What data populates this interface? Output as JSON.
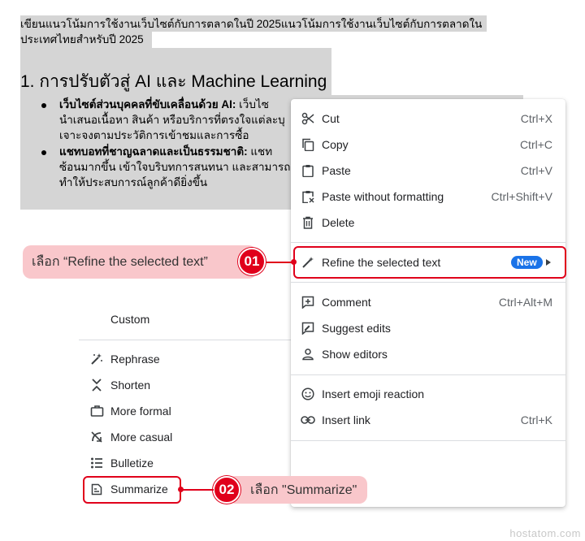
{
  "document": {
    "title_line1": "เขียนแนวโน้มการใช้งานเว็บไซต์กับการตลาดในปี 2025แนวโน้มการใช้งานเว็บไซต์กับการตลาดใน",
    "title_line2": "ประเทศไทยสำหรับปี 2025",
    "heading": "1. การปรับตัวสู่ AI และ Machine Learning",
    "bullet1_bold": "เว็บไซต์ส่วนบุคคลที่ขับเคลื่อนด้วย AI:",
    "bullet1_rest": " เว็บไซ",
    "bullet1_line2": "นำเสนอเนื้อหา สินค้า หรือบริการที่ตรงใจแต่ละบุ",
    "bullet1_line3": "เจาะจงตามประวัติการเข้าชมและการซื้อ",
    "bullet2_bold": "แชทบอทที่ชาญฉลาดและเป็นธรรมชาติ:",
    "bullet2_rest": " แชท",
    "bullet2_line2": "ซ้อนมากขึ้น เข้าใจบริบทการสนทนา และสามารถ",
    "bullet2_line3": "ทำให้ประสบการณ์ลูกค้าดียิ่งขึ้น"
  },
  "context_menu": {
    "items": [
      {
        "label": "Cut",
        "shortcut": "Ctrl+X",
        "icon": "scissors-icon"
      },
      {
        "label": "Copy",
        "shortcut": "Ctrl+C",
        "icon": "copy-icon"
      },
      {
        "label": "Paste",
        "shortcut": "Ctrl+V",
        "icon": "clipboard-icon"
      },
      {
        "label": "Paste without formatting",
        "shortcut": "Ctrl+Shift+V",
        "icon": "clipboard-clear-icon"
      },
      {
        "label": "Delete",
        "shortcut": "",
        "icon": "trash-icon"
      },
      {
        "label": "Refine the selected text",
        "shortcut": "",
        "icon": "magic-pen-icon",
        "badge": "New"
      },
      {
        "label": "Comment",
        "shortcut": "Ctrl+Alt+M",
        "icon": "add-comment-icon"
      },
      {
        "label": "Suggest edits",
        "shortcut": "",
        "icon": "rate-review-icon"
      },
      {
        "label": "Show editors",
        "shortcut": "",
        "icon": "person-icon"
      },
      {
        "label": "Insert emoji reaction",
        "shortcut": "",
        "icon": "emoji-icon"
      },
      {
        "label": "Insert link",
        "shortcut": "Ctrl+K",
        "icon": "link-icon"
      }
    ]
  },
  "submenu": {
    "custom": "Custom",
    "items": [
      {
        "label": "Rephrase",
        "icon": "sparkle-wand-icon"
      },
      {
        "label": "Shorten",
        "icon": "shorten-icon"
      },
      {
        "label": "More formal",
        "icon": "briefcase-icon"
      },
      {
        "label": "More casual",
        "icon": "casual-icon"
      },
      {
        "label": "Bulletize",
        "icon": "bullet-list-icon"
      },
      {
        "label": "Summarize",
        "icon": "summarize-icon"
      }
    ]
  },
  "annotations": {
    "step1_number": "01",
    "step1_text": "เลือก “Refine the selected text”",
    "step2_number": "02",
    "step2_text": "เลือก \"Summarize\""
  },
  "watermark": "hostatom.com",
  "colors": {
    "accent_red": "#e0001b",
    "pill_pink": "#f9c7cb",
    "badge_blue": "#1a73e8",
    "selection_gray": "#d5d5d5"
  }
}
